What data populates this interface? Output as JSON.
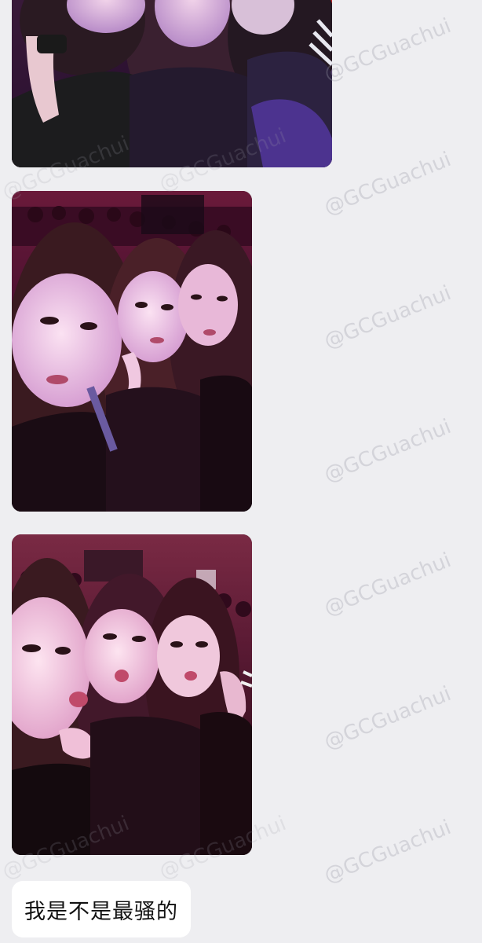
{
  "chat": {
    "photos": [
      {
        "name": "selfie-photo-1",
        "alt": "Selfie of three friends in dark leather jackets under purple light"
      },
      {
        "name": "selfie-photo-2",
        "alt": "Selfie of three friends in a concert hall with red-purple lighting"
      },
      {
        "name": "selfie-photo-3",
        "alt": "Selfie of three friends making kissy faces in a concert hall"
      }
    ],
    "message_text": "我是不是最骚的"
  },
  "watermark": {
    "text": "@GCGuachui"
  },
  "colors": {
    "background": "#eeeef1",
    "bubble": "#ffffff",
    "text": "#111111"
  }
}
